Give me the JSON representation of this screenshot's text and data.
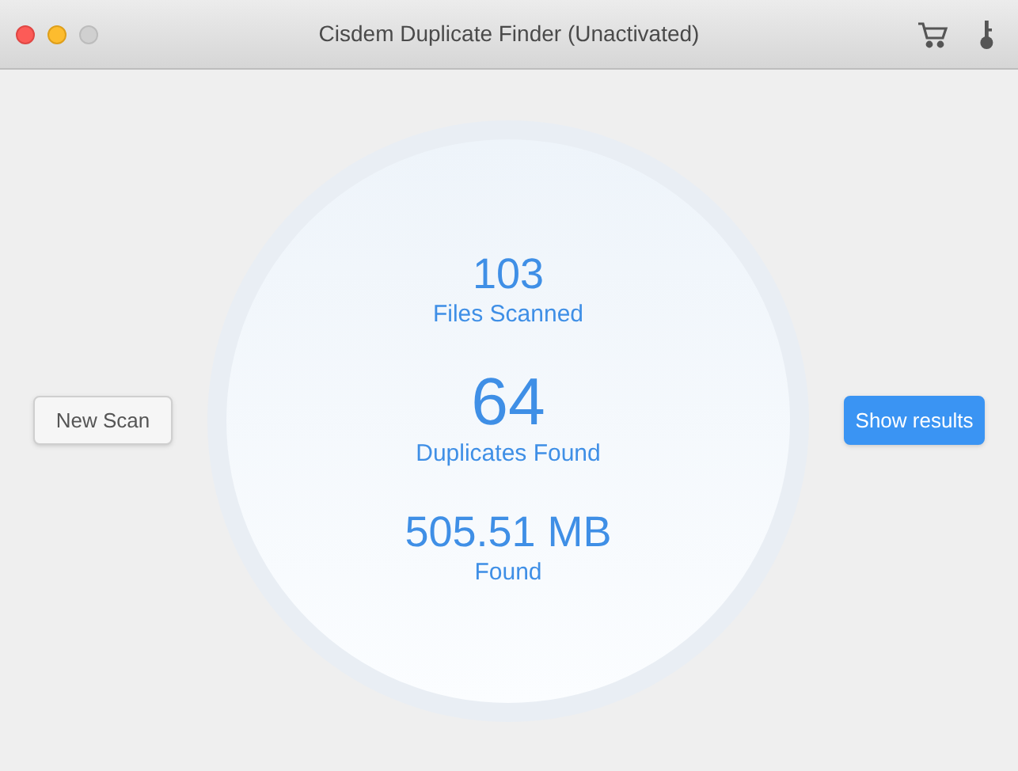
{
  "window": {
    "title": "Cisdem Duplicate Finder (Unactivated)"
  },
  "stats": [
    {
      "kind": "normal",
      "value": "103",
      "label": "Files Scanned"
    },
    {
      "kind": "large",
      "value": "64",
      "label": "Duplicates Found"
    },
    {
      "kind": "normal",
      "value": "505.51 MB",
      "label": "Found"
    }
  ],
  "buttons": [
    {
      "kind": "secondary",
      "label": "New Scan"
    },
    {
      "kind": "primary",
      "label": "Show results"
    }
  ]
}
